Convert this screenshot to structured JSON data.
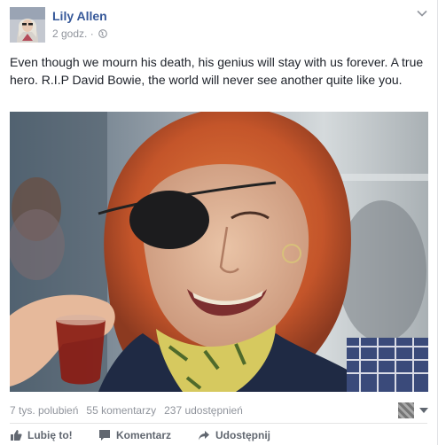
{
  "post": {
    "author": "Lily Allen",
    "time": "2 godz. ·",
    "text": "Even though we mourn his death, his genius will stay with us forever. A true hero. R.I.P David Bowie, the world will never see another quite like you."
  },
  "stats": {
    "likes": "7 tys. polubień",
    "comments": "55 komentarzy",
    "shares": "237 udostępnień"
  },
  "actions": {
    "like": "Lubię to!",
    "comment": "Komentarz",
    "share": "Udostępnij"
  },
  "colors": {
    "author": "#365899",
    "meta": "#90949c",
    "action": "#616770"
  }
}
